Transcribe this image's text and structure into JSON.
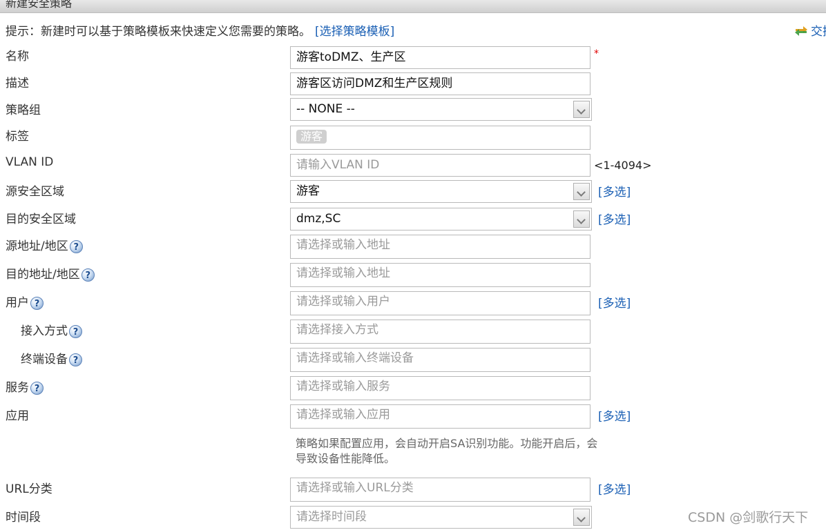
{
  "title": "新建安全策略",
  "hint": {
    "text": "提示：新建时可以基于策略模板来快速定义您需要的策略。",
    "link": "[选择策略模板]",
    "swap_label": "交换",
    "swap_icon": "swap-arrows-icon"
  },
  "name": {
    "label": "名称",
    "value": "游客toDMZ、生产区",
    "required": "*"
  },
  "description": {
    "label": "描述",
    "value": "游客区访问DMZ和生产区规则"
  },
  "policy_group": {
    "label": "策略组",
    "value": "-- NONE --"
  },
  "tag": {
    "label": "标签",
    "value": "游客"
  },
  "vlan": {
    "label": "VLAN ID",
    "placeholder": "请输入VLAN ID",
    "range": "<1-4094>"
  },
  "src_zone": {
    "label": "源安全区域",
    "value": "游客",
    "multi": "[多选]"
  },
  "dst_zone": {
    "label": "目的安全区域",
    "value": "dmz,SC",
    "multi": "[多选]"
  },
  "src_addr": {
    "label": "源地址/地区",
    "placeholder": "请选择或输入地址"
  },
  "dst_addr": {
    "label": "目的地址/地区",
    "placeholder": "请选择或输入地址"
  },
  "user": {
    "label": "用户",
    "placeholder": "请选择或输入用户",
    "multi": "[多选]"
  },
  "access_mode": {
    "label": "接入方式",
    "placeholder": "请选择接入方式"
  },
  "terminal": {
    "label": "终端设备",
    "placeholder": "请选择或输入终端设备"
  },
  "service": {
    "label": "服务",
    "placeholder": "请选择或输入服务"
  },
  "application": {
    "label": "应用",
    "placeholder": "请选择或输入应用",
    "multi": "[多选]",
    "note": "策略如果配置应用，会自动开启SA识别功能。功能开启后，会导致设备性能降低。"
  },
  "url_category": {
    "label": "URL分类",
    "placeholder": "请选择或输入URL分类",
    "multi": "[多选]"
  },
  "time_range": {
    "label": "时间段",
    "placeholder": "请选择时间段"
  },
  "help_glyph": "?",
  "watermark": "CSDN @剑歌行天下",
  "colors": {
    "link": "#1a5fb4",
    "required": "#e00000",
    "tag_bg": "#cfcfcf"
  }
}
